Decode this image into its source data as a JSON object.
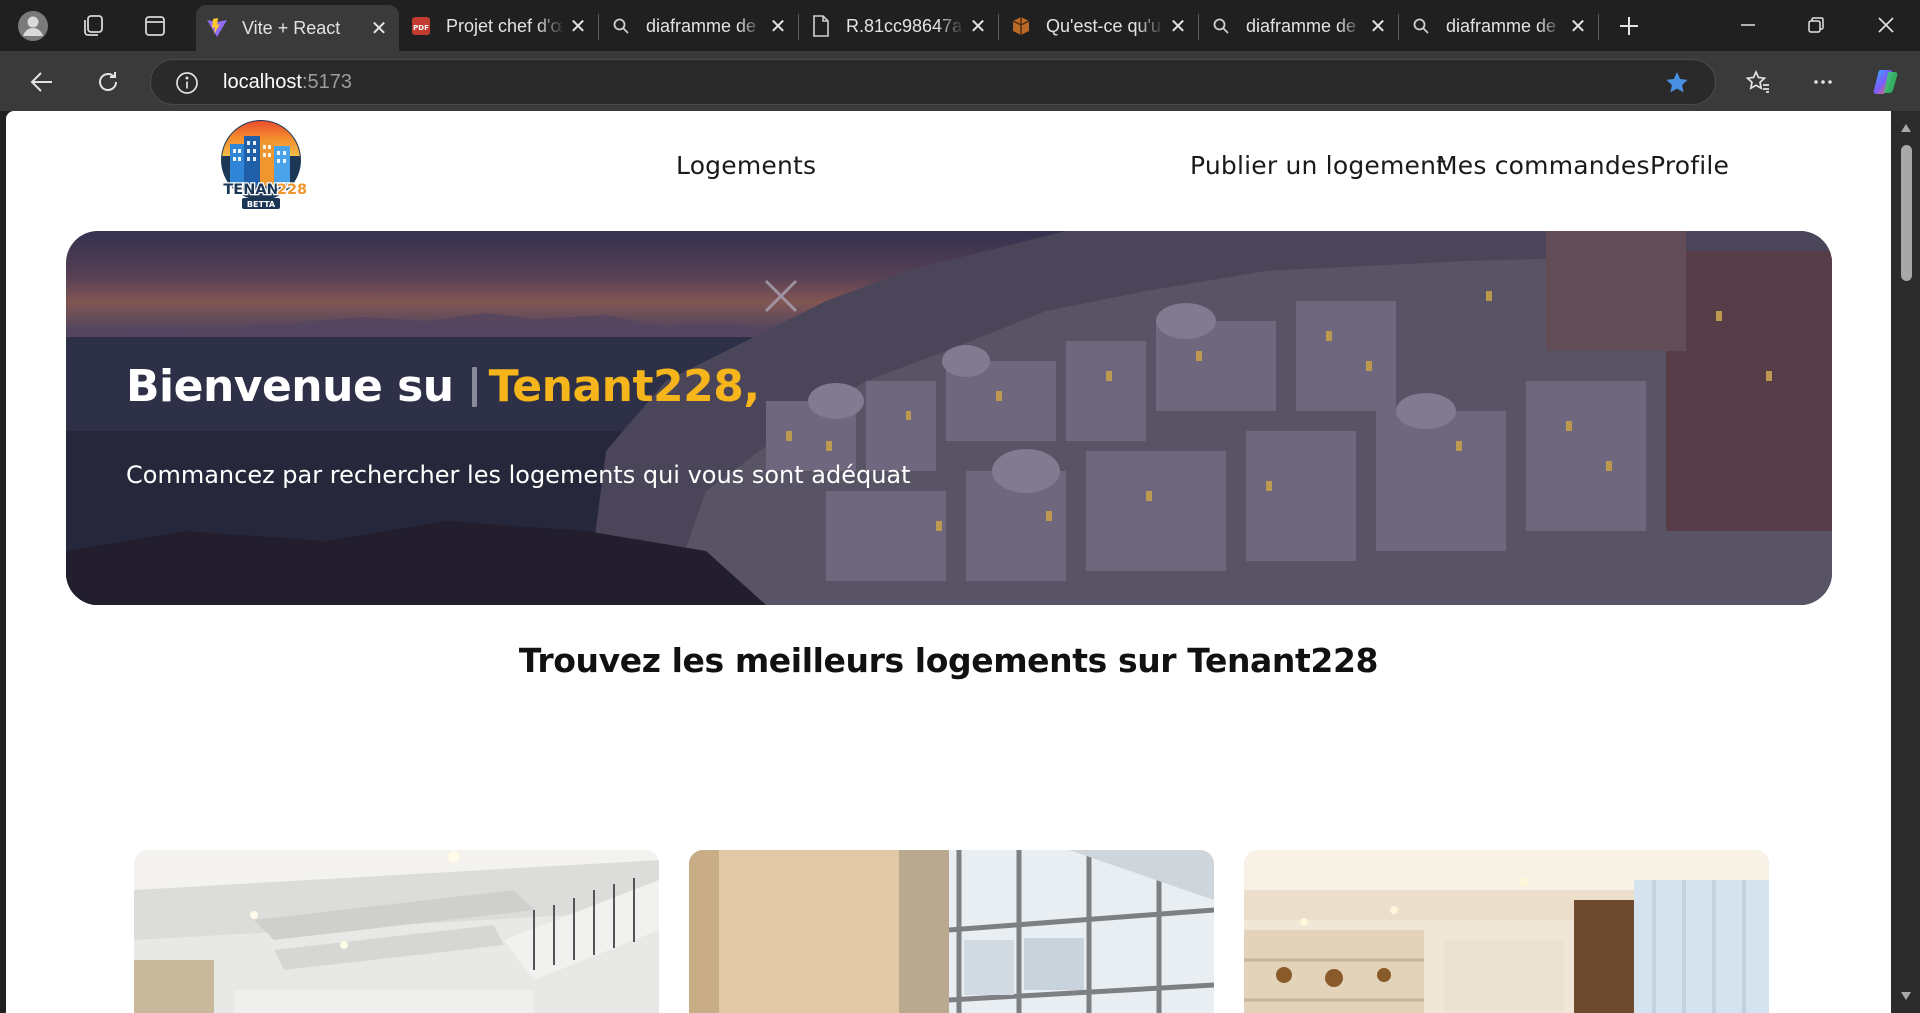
{
  "browser": {
    "tabs": [
      {
        "title": "Vite + React",
        "favicon": "vite-icon",
        "active": true
      },
      {
        "title": "Projet chef d'œ",
        "favicon": "pdf-icon",
        "active": false
      },
      {
        "title": "diaframme de",
        "favicon": "search-icon",
        "active": false
      },
      {
        "title": "R.81cc98647a",
        "favicon": "file-icon",
        "active": false
      },
      {
        "title": "Qu'est-ce qu'u",
        "favicon": "site-icon",
        "active": false
      },
      {
        "title": "diaframme de",
        "favicon": "search-icon",
        "active": false
      },
      {
        "title": "diaframme de",
        "favicon": "search-icon",
        "active": false
      }
    ],
    "address": {
      "host": "localhost",
      "port": ":5173"
    },
    "colors": {
      "tabstrip": "#202020",
      "toolbar": "#3a3a3a",
      "favorite_star": "#4a90e2"
    }
  },
  "site": {
    "logo": {
      "line1": "TENANT",
      "line2": "228",
      "line3": "BETTA"
    },
    "nav": {
      "logements": "Logements",
      "publier": "Publier un logement",
      "commandes": "Mes commandes",
      "profile": "Profile"
    },
    "hero": {
      "title_prefix": "Bienvenue su",
      "title_brand": "Tenant228,",
      "subtitle": "Commancez par rechercher les logements qui vous sont adéquat"
    },
    "section_title": "Trouvez les meilleurs logements sur Tenant228",
    "colors": {
      "brand_yellow": "#f5b51b",
      "text_dark": "#111111"
    }
  }
}
